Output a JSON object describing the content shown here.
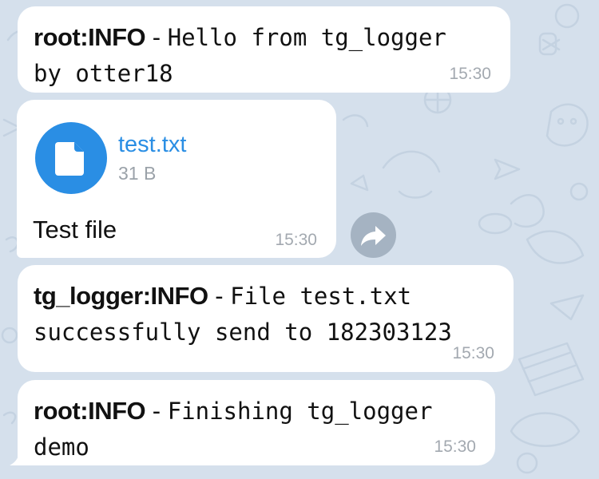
{
  "messages": [
    {
      "tag": "root:INFO",
      "separator": " - ",
      "line1": "Hello from tg_logger",
      "line2": "by otter18",
      "time": "15:30"
    },
    {
      "file": {
        "name": "test.txt",
        "size": "31 B",
        "icon": "document-icon",
        "accent": "#2a8ee4"
      },
      "caption": "Test file",
      "time": "15:30",
      "share_icon": "share-forward-icon"
    },
    {
      "tag": "tg_logger:INFO",
      "separator": " - ",
      "line1": "File test.txt",
      "line2": "successfully send to 182303123",
      "time": "15:30"
    },
    {
      "tag": "root:INFO",
      "separator": " - ",
      "line1": "Finishing tg_logger",
      "line2": "demo",
      "time": "15:30"
    }
  ],
  "theme": {
    "background": "#d5e0ec",
    "bubble": "#ffffff",
    "timestamp": "#a3a9b0",
    "share_button": "#a5b3c2"
  }
}
